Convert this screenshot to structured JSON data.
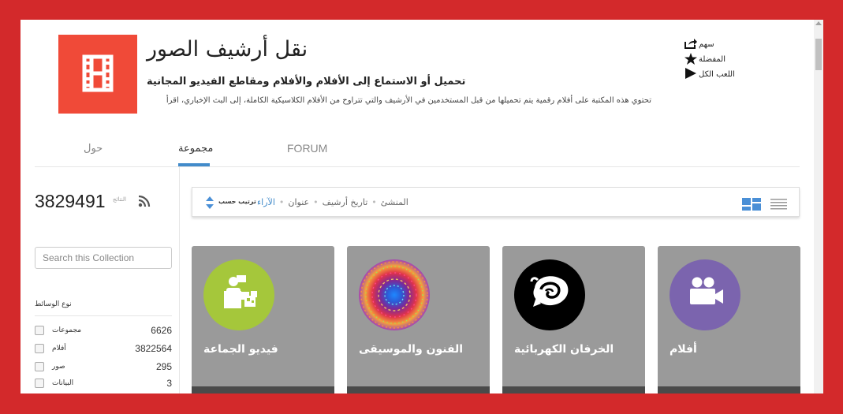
{
  "header": {
    "title": "نقل أرشيف الصور",
    "subtitle": "تحميل أو الاستماع إلى الأفلام والأفلام ومقاطع الفيديو المجانية",
    "description": "تحتوي هذه المكتبة على أفلام رقمية يتم تحميلها من قبل المستخدمين في الأرشيف والتي تتراوح من الأفلام الكلاسيكية الكاملة، إلى البث الإخباري، اقرأ",
    "logo_icon": "film-strip-icon",
    "logo_color": "#f04a38"
  },
  "actions": {
    "share_label": "سهم",
    "favorite_label": "المفضلة",
    "play_all_label": "اللعب الكل"
  },
  "tabs": {
    "about": "حول",
    "collection": "مجموعة",
    "forum": "FORUM"
  },
  "sidebar": {
    "results_label": "النتائج",
    "results_count": "3829491",
    "search_placeholder": "Search this Collection",
    "facet_title": "نوع الوسائط",
    "facets": [
      {
        "label": "مجموعات",
        "count": "6626"
      },
      {
        "label": "أفلام",
        "count": "3822564"
      },
      {
        "label": "صور",
        "count": "295"
      },
      {
        "label": "البيانات",
        "count": "3"
      }
    ]
  },
  "sortbar": {
    "sort_label": "ترتيب حسب",
    "options": [
      "الآراء",
      "عنوان",
      "تاريخ أرشيف",
      "المنشئ"
    ],
    "active_option": "الآراء"
  },
  "tiles": [
    {
      "title": "فيديو الجماعة",
      "icon": "community-video-icon",
      "circle_color": "#a5c73b"
    },
    {
      "title": "الفنون والموسيقى",
      "icon": "psychedelic-art-image",
      "circle_color": "#3a79d8"
    },
    {
      "title": "الخرفان الكهربائية",
      "icon": "electric-sheep-logo",
      "circle_color": "#000000"
    },
    {
      "title": "أفلام",
      "icon": "video-camera-icon",
      "circle_color": "#7b64ae"
    }
  ],
  "colors": {
    "page_border": "#d3292b",
    "accent": "#428bca",
    "tile_bg": "#9a9a9a"
  }
}
